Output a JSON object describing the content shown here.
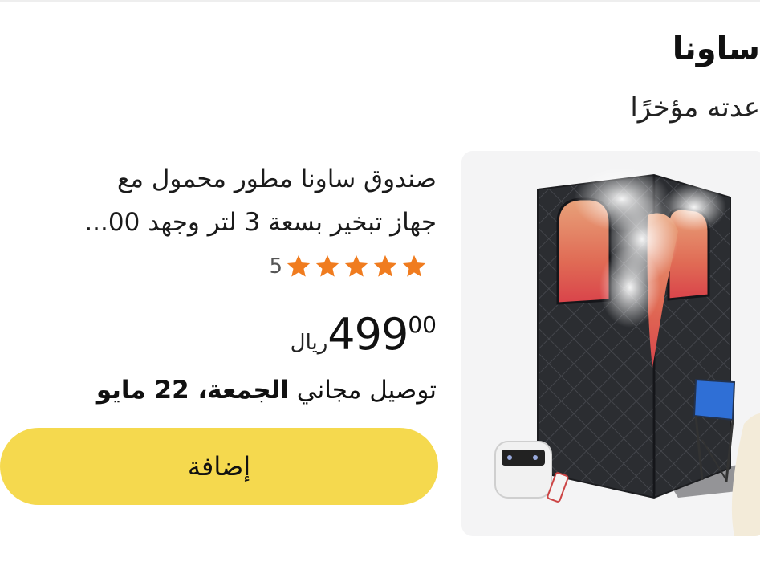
{
  "section": {
    "title": "ساونا",
    "subtitle": "عدته مؤخرًا"
  },
  "product": {
    "title_line1": "صندوق ساونا مطور محمول مع",
    "title_line2": "جهاز تبخير بسعة 3 لتر وجهد 00...",
    "rating": 5,
    "rating_count": "5",
    "price_integer": "499",
    "price_decimal": "00",
    "currency": "ريال",
    "delivery_prefix": "توصيل مجاني",
    "delivery_date": "الجمعة، 22 مايو",
    "add_label": "إضافة"
  },
  "colors": {
    "star": "#f07c1f",
    "button": "#f5d94e",
    "image_bg": "#f4f4f5"
  }
}
